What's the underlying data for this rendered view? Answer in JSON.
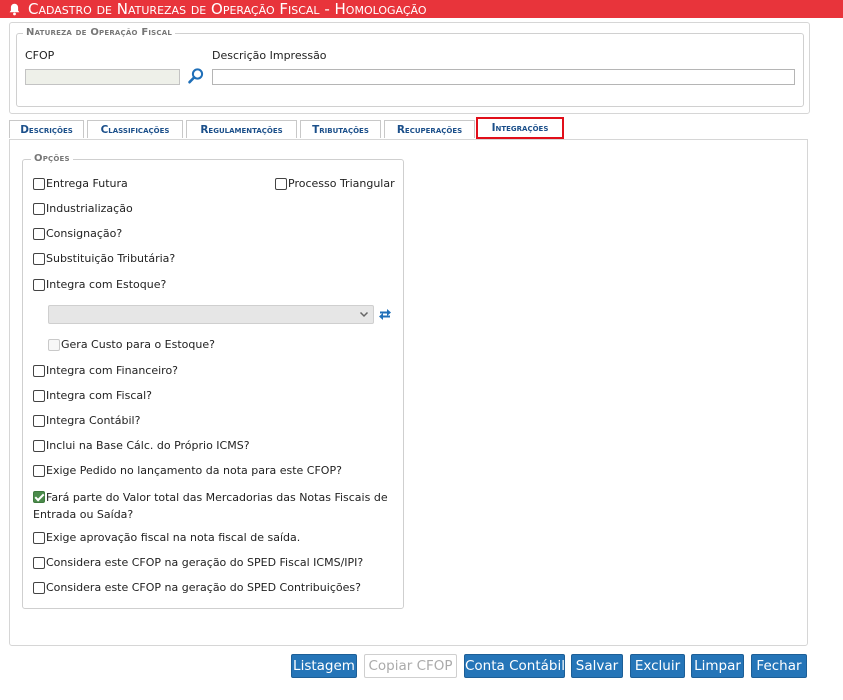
{
  "window": {
    "title": "Cadastro de Naturezas de Operação Fiscal  - Homologação"
  },
  "header": {
    "legend": "Natureza de Operação Fiscal",
    "cfop_label": "CFOP",
    "cfop_value": "",
    "desc_label": "Descrição Impressão",
    "desc_value": ""
  },
  "tabs": [
    {
      "label": "Descrições"
    },
    {
      "label": "Classificações"
    },
    {
      "label": "Regulamentações"
    },
    {
      "label": "Tributações"
    },
    {
      "label": "Recuperações"
    },
    {
      "label": "Integrações"
    }
  ],
  "options": {
    "legend": "Opções",
    "entrega_futura": "Entrega Futura",
    "processo_triangular": "Processo Triangular",
    "industrializacao": "Industrialização",
    "consignacao": "Consignação?",
    "substituicao": "Substituição Tributária?",
    "integra_estoque": "Integra com Estoque?",
    "estoque_select_value": "",
    "gera_custo": "Gera Custo para o Estoque?",
    "integra_financeiro": "Integra com Financeiro?",
    "integra_fiscal": "Integra com Fiscal?",
    "integra_contabil": "Integra Contábil?",
    "inclui_base": "Inclui na Base Cálc. do Próprio ICMS?",
    "exige_pedido": "Exige Pedido no lançamento da nota para este CFOP?",
    "fara_parte": "Fará parte do Valor total das Mercadorias das Notas Fiscais de Entrada ou Saída?",
    "exige_aprovacao": "Exige aprovação fiscal na nota fiscal de saída.",
    "sped_fiscal": "Considera este CFOP na geração do SPED Fiscal ICMS/IPI?",
    "sped_contrib": "Considera este CFOP na geração do SPED Contribuições?"
  },
  "buttons": {
    "listagem": "Listagem",
    "copiar": "Copiar CFOP",
    "conta_contabil": "Conta Contábil",
    "salvar": "Salvar",
    "excluir": "Excluir",
    "limpar": "Limpar",
    "fechar": "Fechar"
  },
  "colors": {
    "title_bar": "#e8343b",
    "accent": "#2575b8",
    "tab_text": "#1b4f8a",
    "highlight": "#e10f1a"
  }
}
